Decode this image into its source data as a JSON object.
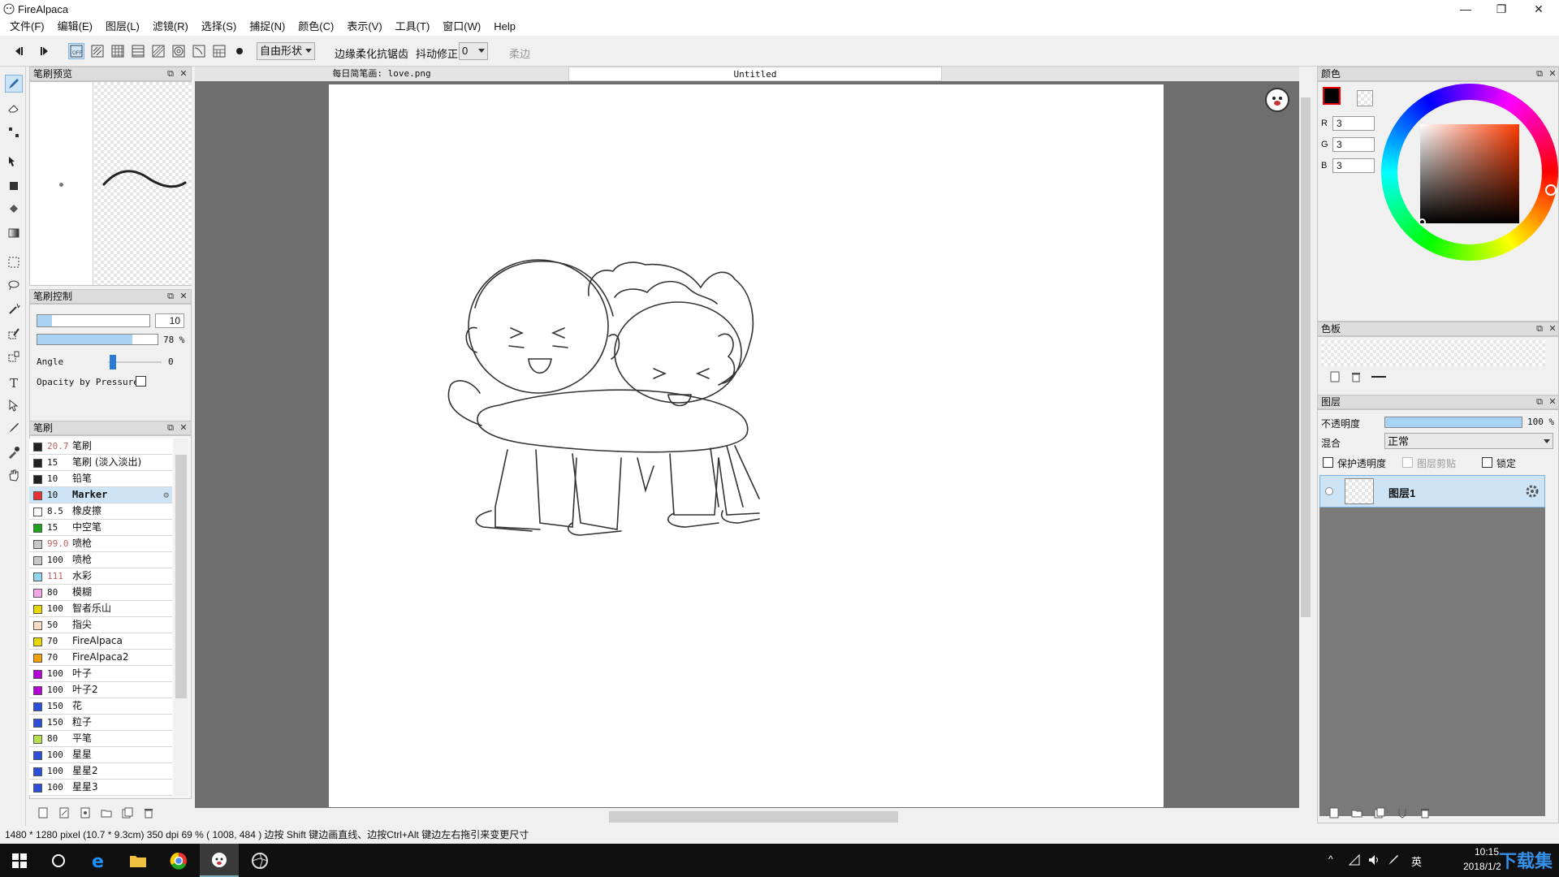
{
  "window": {
    "title": "FireAlpaca"
  },
  "menu": [
    "文件(F)",
    "编辑(E)",
    "图层(L)",
    "滤镜(R)",
    "选择(S)",
    "捕捉(N)",
    "颜色(C)",
    "表示(V)",
    "工具(T)",
    "窗口(W)",
    "Help"
  ],
  "toolbar": {
    "snap_mode": "自由形状",
    "antialias_label": "边缘柔化抗锯齿",
    "stabilizer_label": "抖动修正",
    "stabilizer_value": "0",
    "soft_label": "柔边"
  },
  "brush_preview": {
    "title": "笔刷预览"
  },
  "brush_control": {
    "title": "笔刷控制",
    "size_value": "10",
    "opacity_value": "78 %",
    "opacity_fraction": 0.78,
    "angle_label": "Angle",
    "angle_value": "0",
    "pressure_label": "Opacity by Pressure"
  },
  "brushes": {
    "title": "笔刷",
    "items": [
      {
        "size": "20.7",
        "name": "笔刷",
        "color": "#222222",
        "dim": true
      },
      {
        "size": "15",
        "name": "笔刷 (淡入淡出)",
        "color": "#222222"
      },
      {
        "size": "10",
        "name": "铅笔",
        "color": "#222222"
      },
      {
        "size": "10",
        "name": "Marker",
        "color": "#e83030",
        "selected": true
      },
      {
        "size": "8.5",
        "name": "橡皮擦",
        "color": "#ffffff"
      },
      {
        "size": "15",
        "name": "中空笔",
        "color": "#1fa31f"
      },
      {
        "size": "99.0",
        "name": "喷枪",
        "color": "#c8c8c8",
        "dim": true
      },
      {
        "size": "100",
        "name": "喷枪",
        "color": "#c8c8c8"
      },
      {
        "size": "111",
        "name": "水彩",
        "color": "#8fd8ef",
        "dim": true
      },
      {
        "size": "80",
        "name": "模糊",
        "color": "#f5a6e6"
      },
      {
        "size": "100",
        "name": "智者乐山",
        "color": "#e6d800"
      },
      {
        "size": "50",
        "name": "指尖",
        "color": "#f7dcc2"
      },
      {
        "size": "70",
        "name": "FireAlpaca",
        "color": "#e6d800"
      },
      {
        "size": "70",
        "name": "FireAlpaca2",
        "color": "#f0a000"
      },
      {
        "size": "100",
        "name": "叶子",
        "color": "#b400d6"
      },
      {
        "size": "100",
        "name": "叶子2",
        "color": "#b400d6"
      },
      {
        "size": "150",
        "name": "花",
        "color": "#2a4fd8"
      },
      {
        "size": "150",
        "name": "粒子",
        "color": "#2a4fd8"
      },
      {
        "size": "80",
        "name": "平笔",
        "color": "#b3e04c"
      },
      {
        "size": "100",
        "name": "星星",
        "color": "#2a4fd8"
      },
      {
        "size": "100",
        "name": "星星2",
        "color": "#2a4fd8"
      },
      {
        "size": "100",
        "name": "星星3",
        "color": "#2a4fd8"
      }
    ]
  },
  "docs": {
    "tab1": "每日简笔画: love.png",
    "tab2": "Untitled"
  },
  "color_panel": {
    "title": "颜色",
    "r": "3",
    "g": "3",
    "b": "3",
    "r_label": "R",
    "g_label": "G",
    "b_label": "B",
    "fg_color": "#030303"
  },
  "palette_panel": {
    "title": "色板"
  },
  "layer_panel": {
    "title": "图层",
    "opacity_label": "不透明度",
    "opacity_value": "100 %",
    "blend_label": "混合",
    "blend_value": "正常",
    "protect_label": "保护透明度",
    "clip_label": "图层剪贴",
    "lock_label": "锁定",
    "layer_name": "图层1"
  },
  "status": {
    "text": "1480 * 1280 pixel  (10.7 * 9.3cm)  350 dpi  69 %  ( 1008, 484 )  边按 Shift 键边画直线、边按Ctrl+Alt 键边左右拖引来变更尺寸"
  },
  "taskbar": {
    "ime": "英",
    "time": "10:15",
    "date": "2018/1/2",
    "watermark": "下载集"
  },
  "colors": {
    "accent": "#cde4f7",
    "canvas_bg": "#6e6e6e"
  }
}
